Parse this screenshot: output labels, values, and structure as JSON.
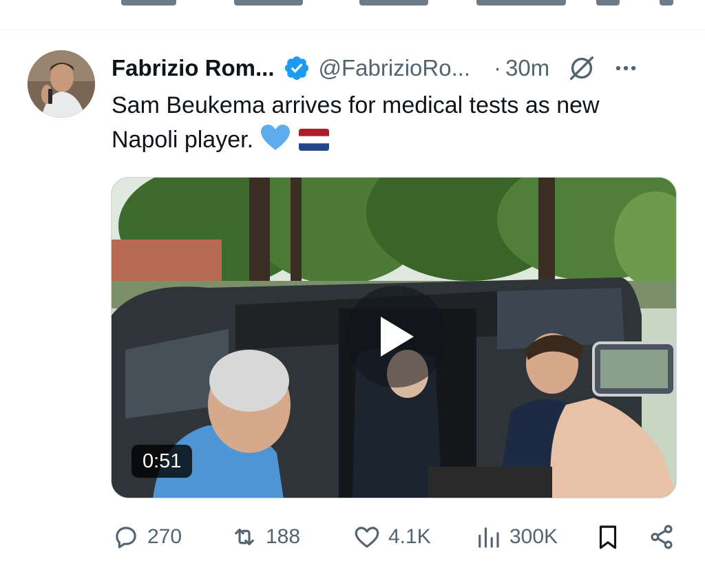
{
  "tweet": {
    "author_name": "Fabrizio Rom...",
    "handle": "@FabrizioRo...",
    "separator": "·",
    "time": "30m",
    "text": "Sam Beukema arrives for medical tests as new Napoli player.",
    "emojis": [
      "blue-heart",
      "netherlands-flag"
    ],
    "verified": true
  },
  "media": {
    "type": "video",
    "duration": "0:51"
  },
  "actions": {
    "replies": "270",
    "reposts": "188",
    "likes": "4.1K",
    "views": "300K"
  },
  "colors": {
    "text_primary": "#0f1419",
    "text_secondary": "#536471",
    "verified_blue": "#1d9bf0",
    "divider": "#eff3f4"
  },
  "icons": {
    "verified": "verified-badge-icon",
    "grok": "grok-icon",
    "more": "more-horizontal-icon",
    "reply": "reply-icon",
    "repost": "repost-icon",
    "like": "like-icon",
    "views": "views-icon",
    "bookmark": "bookmark-icon",
    "share": "share-icon",
    "play": "play-icon"
  }
}
